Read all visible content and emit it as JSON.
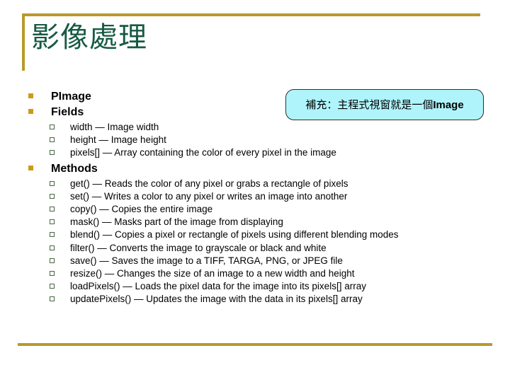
{
  "slide": {
    "title": "影像處理",
    "accent_color": "#b9992b",
    "title_color": "#165a43",
    "background": "#ffffff"
  },
  "callout": {
    "text_prefix": "補充：主程式視窗就是一個",
    "text_emphasis": "Image",
    "background": "#b0f4fb",
    "border_color": "#2d2d2d"
  },
  "outline": [
    {
      "label": "PImage",
      "children": []
    },
    {
      "label": "Fields",
      "children": [
        "width — Image width",
        "height — Image height",
        "pixels[] — Array containing the color of every pixel in the image"
      ]
    },
    {
      "label": "Methods",
      "children": [
        "get() — Reads the color of any pixel or grabs a rectangle of pixels",
        "set() — Writes a color to any pixel or writes an image into another",
        "copy() — Copies the entire image",
        "mask() — Masks part of the image from displaying",
        "blend() — Copies a pixel or rectangle of pixels using different blending modes",
        "filter() — Converts the image to grayscale or black and white",
        "save() — Saves the image to a TIFF, TARGA, PNG, or JPEG file",
        "resize() — Changes the size of an image to a new width and height",
        "loadPixels() — Loads the pixel data for the image into its pixels[] array",
        "updatePixels() — Updates the image with the data in its pixels[] array"
      ]
    }
  ]
}
